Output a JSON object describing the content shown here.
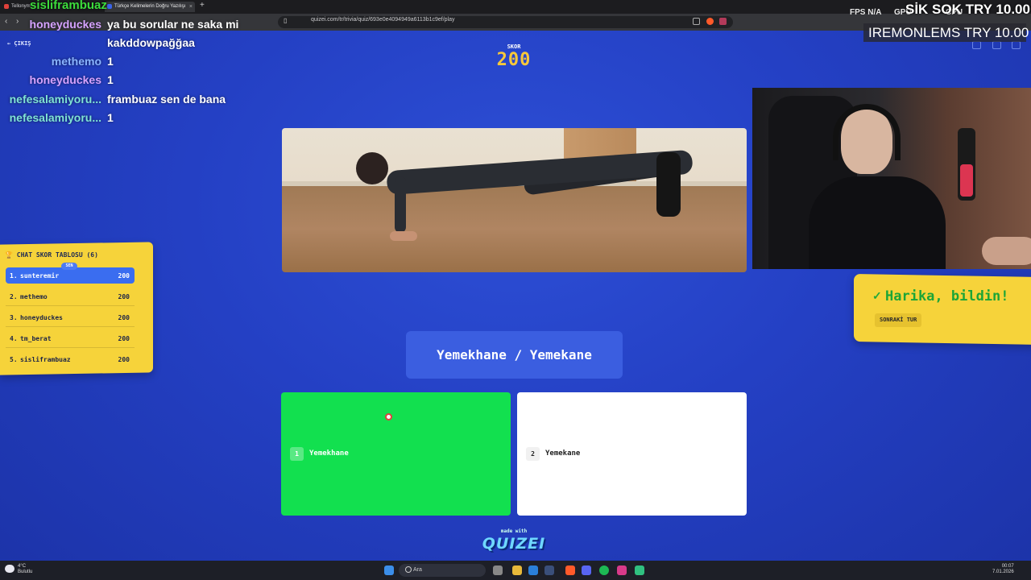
{
  "browser": {
    "tabs": [
      {
        "label": "Tellonym"
      },
      {
        "label": "Türkçe Kelimelerin Doğru Yazılışı"
      }
    ],
    "new_tab": "+",
    "back": "‹",
    "forward": "›",
    "url": "quizei.com/tr/trivia/quiz/693e0e4094949a6113b1c9ef/play"
  },
  "chat": {
    "top_user": "sisliframbuaz",
    "messages": [
      {
        "user": "honeyduckes",
        "text": "ya bu sorular ne saka mi",
        "color": "#d6a3ff"
      },
      {
        "user": "",
        "text": "kakddowpağğaa",
        "color": "#d6a3ff"
      },
      {
        "user": "methemo",
        "text": "1",
        "color": "#8ab4ff"
      },
      {
        "user": "honeyduckes",
        "text": "1",
        "color": "#d6a3ff"
      },
      {
        "user": "nefesalamiyoru...",
        "text": "frambuaz sen de bana",
        "color": "#7fe3d6"
      },
      {
        "user": "nefesalamiyoru...",
        "text": "1",
        "color": "#7fe3d6"
      }
    ]
  },
  "exit": "← ÇIKIŞ",
  "score": {
    "label": "SKOR",
    "value": "200"
  },
  "leaderboard": {
    "title": "CHAT SKOR TABLOSU (6)",
    "you_badge": "SEN",
    "rows": [
      {
        "rank": "1.",
        "name": "sunteremir",
        "points": "200"
      },
      {
        "rank": "2.",
        "name": "methemo",
        "points": "200"
      },
      {
        "rank": "3.",
        "name": "honeyduckes",
        "points": "200"
      },
      {
        "rank": "4.",
        "name": "tm_berat",
        "points": "200"
      },
      {
        "rank": "5.",
        "name": "sisliframbuaz",
        "points": "200"
      }
    ]
  },
  "result": {
    "text": "Harika, bildin!",
    "next_button": "SONRAKİ TUR",
    "check": "✓"
  },
  "question": {
    "text": "Yemekhane / Yemekane"
  },
  "answers": [
    {
      "num": "1",
      "label": "Yemekhane",
      "state": "correct"
    },
    {
      "num": "2",
      "label": "Yemekane",
      "state": "default"
    }
  ],
  "footer": {
    "made_with": "made with",
    "brand": "QUIZEI"
  },
  "overlay": {
    "fps_label": "FPS",
    "fps_value": "N/A",
    "gpu_label": "GPU",
    "cpu_label": "CPU",
    "donation_top": "SİK SOK  TRY 10.00",
    "donation_bottom": "IREMONLEMS  TRY 10.00"
  },
  "taskbar": {
    "temp": "4°C",
    "weather": "Bulutlu",
    "search": "Ara",
    "time": "00:07",
    "date": "7.01.2026"
  },
  "colors": {
    "background": "#2440c4",
    "accent_yellow": "#f6d33a",
    "correct_green": "#12e04f",
    "score_gold": "#f7c83a"
  }
}
